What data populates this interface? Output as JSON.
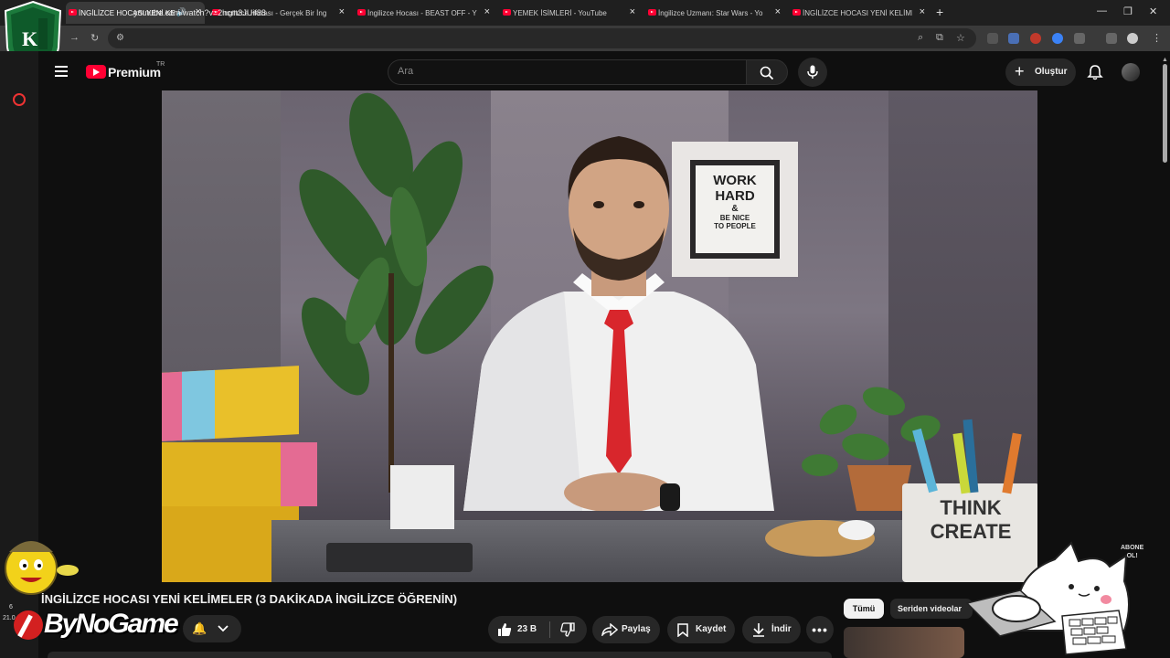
{
  "browser": {
    "tabs": [
      {
        "label": "İNGİLİZCE HOCASI YENİ KE",
        "active": true
      },
      {
        "label": "İngilizce Hocası - Gerçek Bir İng"
      },
      {
        "label": "İngilizce Hocası - BEAST OFF - Y"
      },
      {
        "label": "YEMEK İSİMLERİ - YouTube"
      },
      {
        "label": "İngilizce Uzmanı: Star Wars - Yo"
      },
      {
        "label": "İNGİLİZCE HOCASI YENİ KELİME"
      }
    ],
    "new_tab": "+",
    "url": "youtube.com/watch?v=2ncm3JUif88"
  },
  "youtube": {
    "logo_text": "Premium",
    "logo_region": "TR",
    "search_placeholder": "Ara",
    "create_label": "Oluştur"
  },
  "video": {
    "poster_text": [
      "WORK",
      "HARD",
      "&",
      "BE NICE",
      "TO PEOPLE"
    ],
    "mug_text": [
      "THINK",
      "CREATE"
    ],
    "subscribe_watermark": [
      "ABONE",
      "OL!"
    ]
  },
  "watch": {
    "title": "İNGİLİZCE HOCASI YENİ KELİMELER (3 DAKİKADA İNGİLİZCE ÖĞRENİN)",
    "like_count": "23 B",
    "share_label": "Paylaş",
    "save_label": "Kaydet",
    "download_label": "İndir"
  },
  "chips": {
    "all": "Tümü",
    "series": "Seriden videolar"
  },
  "overlay": {
    "brand": "ByNoGame",
    "small_left_1": "6",
    "small_left_2": "21.0"
  }
}
